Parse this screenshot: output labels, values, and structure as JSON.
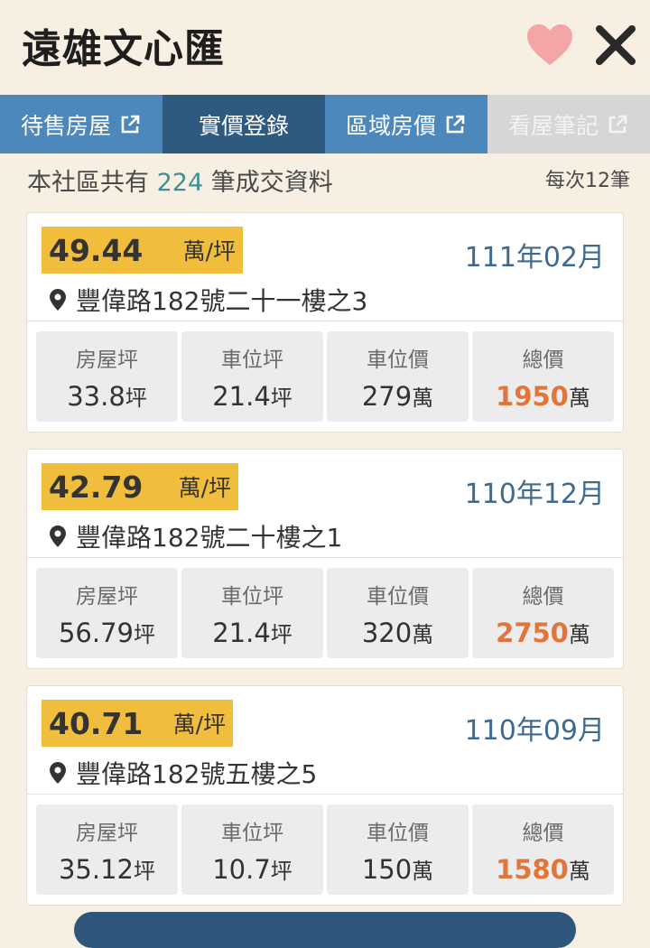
{
  "header": {
    "title": "遠雄文心匯"
  },
  "tabs": [
    {
      "label": "待售房屋",
      "state": "normal",
      "external": true
    },
    {
      "label": "實價登錄",
      "state": "active",
      "external": false
    },
    {
      "label": "區域房價",
      "state": "normal",
      "external": true
    },
    {
      "label": "看屋筆記",
      "state": "disabled",
      "external": true
    }
  ],
  "summary": {
    "prefix": "本社區共有",
    "count": "224",
    "suffix": "筆成交資料",
    "per_page": "每次12筆"
  },
  "stat_labels": {
    "area": "房屋坪",
    "parking_area": "車位坪",
    "parking_price": "車位價",
    "total": "總價"
  },
  "units": {
    "ping": "坪",
    "wan": "萬",
    "wan_per_ping": "萬/坪"
  },
  "records": [
    {
      "unit_price": "49.44",
      "date": "111年02月",
      "address": "豐偉路182號二十一樓之3",
      "area": "33.8",
      "parking_area": "21.4",
      "parking_price": "279",
      "total": "1950"
    },
    {
      "unit_price": "42.79",
      "date": "110年12月",
      "address": "豐偉路182號二十樓之1",
      "area": "56.79",
      "parking_area": "21.4",
      "parking_price": "320",
      "total": "2750"
    },
    {
      "unit_price": "40.71",
      "date": "110年09月",
      "address": "豐偉路182號五樓之5",
      "area": "35.12",
      "parking_area": "10.7",
      "parking_price": "150",
      "total": "1580"
    }
  ],
  "colors": {
    "accent_tab": "#4d88bd",
    "active_tab": "#2f5a80",
    "price_tag": "#f0bd3c",
    "total_price": "#e2753a",
    "heart": "#f4a6a6"
  }
}
